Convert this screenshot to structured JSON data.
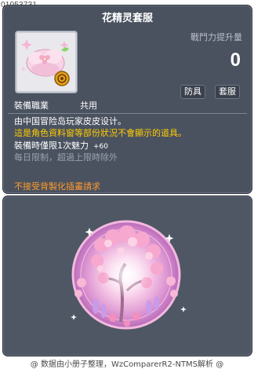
{
  "item_id": "01053731",
  "item": {
    "name": "花精灵套服",
    "icon": "flower-spirit-suit-icon",
    "power_label": "戰鬥力提升量",
    "power_value": "0",
    "tags": [
      "防具",
      "套服"
    ],
    "job_label": "裝備職業",
    "job_value": "共用"
  },
  "description": {
    "line1": "由中国冒险岛玩家皮皮设计。",
    "line2": "這是角色資料窗等部份狀況不會顯示的道具。",
    "line3": "裝備時僅限1次魅力",
    "line3_bonus": "+60",
    "line4": "每日限制，超過上限時除外",
    "line5": "不接受背製化插畫請求"
  },
  "preview": {
    "image": "flower-spirit-preview-icon"
  },
  "footer": "@ 数据由小册子整理，WzComparerR2-NTMS解析 @",
  "colors": {
    "panel": "#4a5260",
    "yellow_text": "#ffcc00",
    "orange_text": "#ff9a2a",
    "grey_text": "#9aa1ad"
  }
}
